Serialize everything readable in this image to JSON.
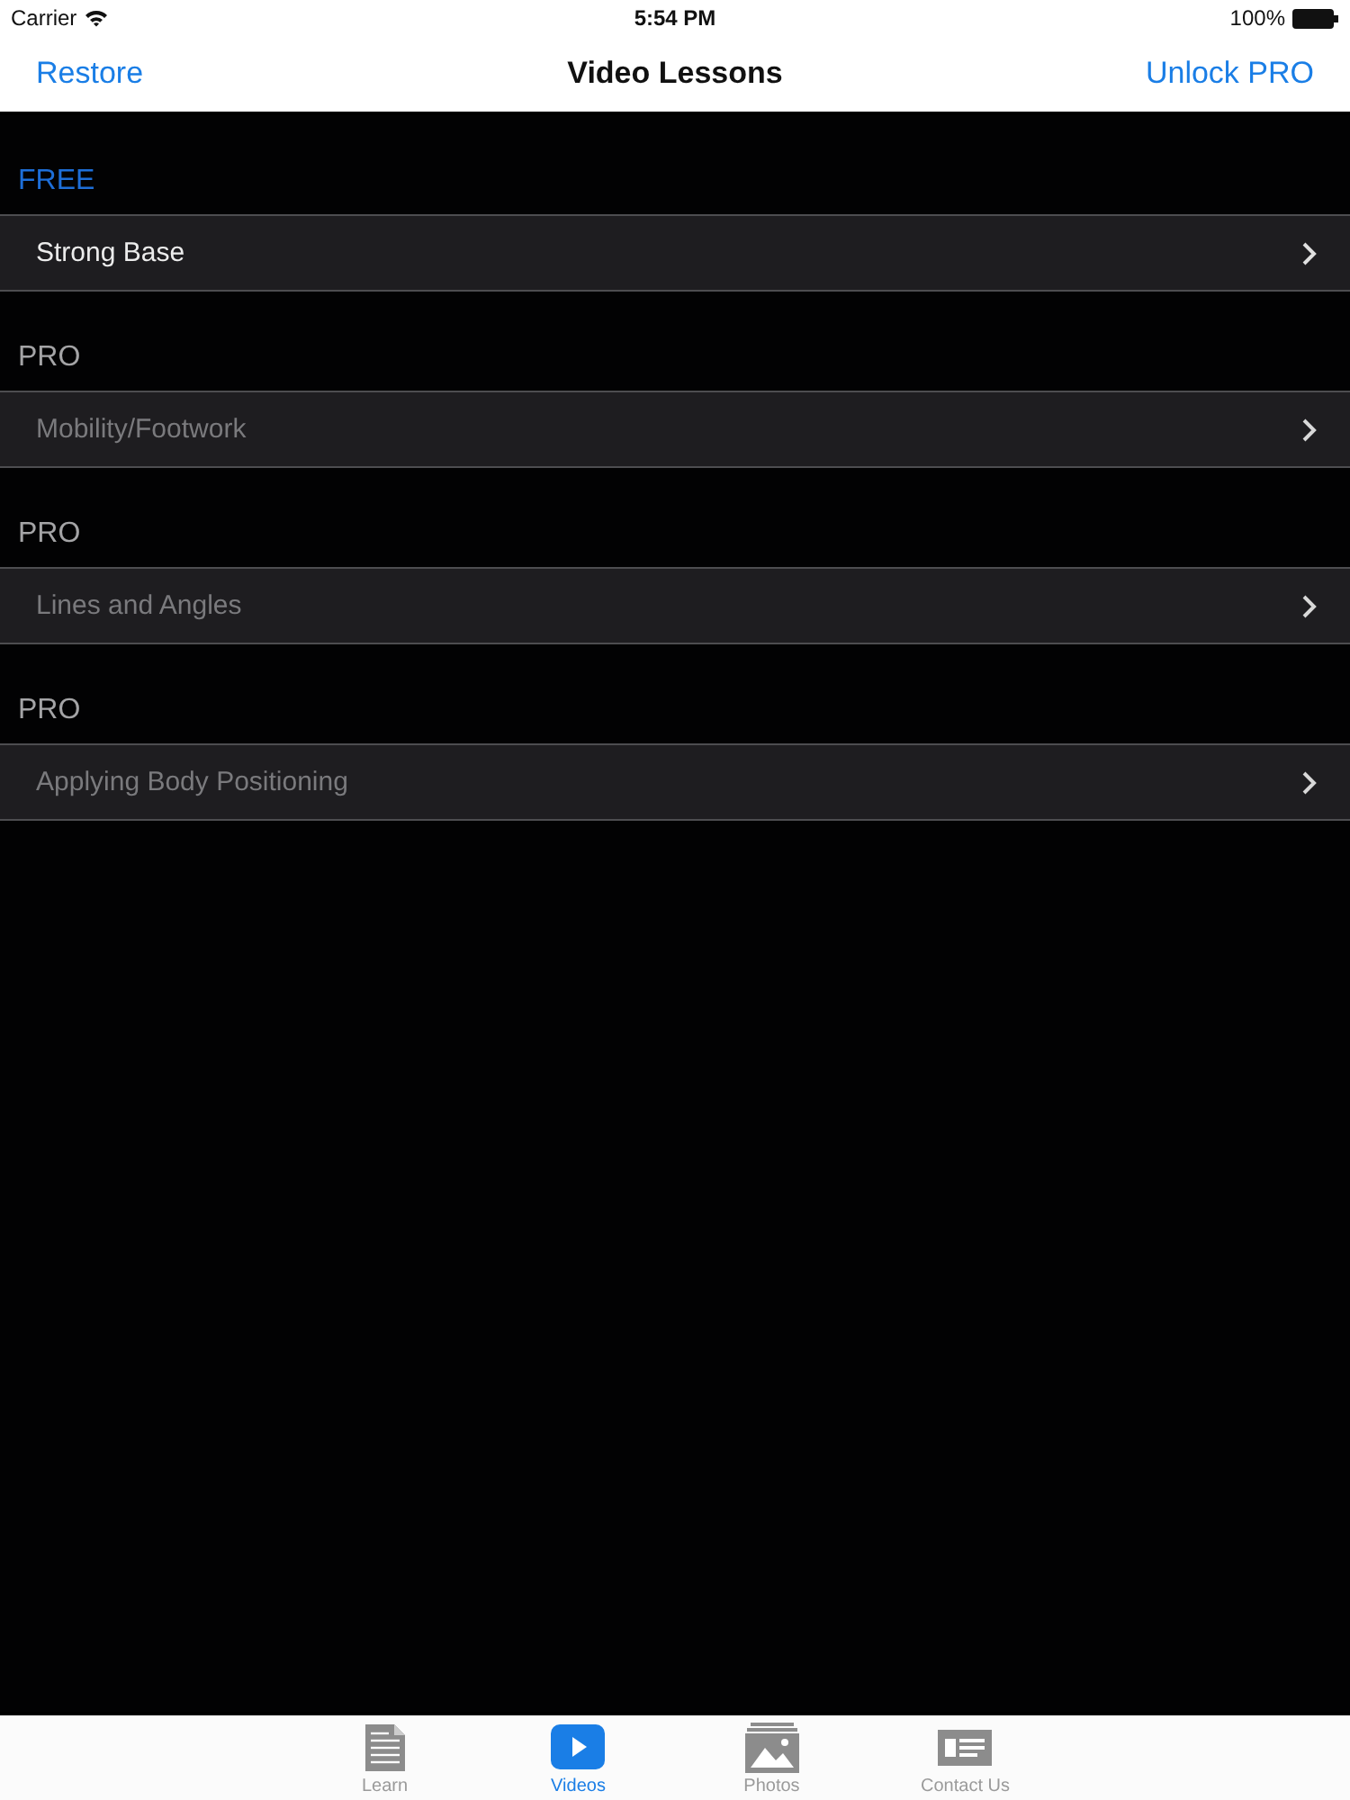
{
  "status_bar": {
    "carrier": "Carrier",
    "time": "5:54 PM",
    "battery": "100%"
  },
  "nav_bar": {
    "left_button": "Restore",
    "title": "Video Lessons",
    "right_button": "Unlock PRO"
  },
  "sections": [
    {
      "header": "FREE",
      "kind": "free",
      "rows": [
        {
          "label": "Strong Base",
          "disabled": false
        }
      ]
    },
    {
      "header": "PRO",
      "kind": "pro",
      "rows": [
        {
          "label": "Mobility/Footwork",
          "disabled": true
        }
      ]
    },
    {
      "header": "PRO",
      "kind": "pro",
      "rows": [
        {
          "label": "Lines and Angles",
          "disabled": true
        }
      ]
    },
    {
      "header": "PRO",
      "kind": "pro",
      "rows": [
        {
          "label": "Applying Body Positioning",
          "disabled": true
        }
      ]
    }
  ],
  "tab_bar": [
    {
      "label": "Learn",
      "kind": "document",
      "selected": false
    },
    {
      "label": "Videos",
      "kind": "play",
      "selected": true
    },
    {
      "label": "Photos",
      "kind": "photos",
      "selected": false
    },
    {
      "label": "Contact Us",
      "kind": "card",
      "selected": false
    }
  ]
}
